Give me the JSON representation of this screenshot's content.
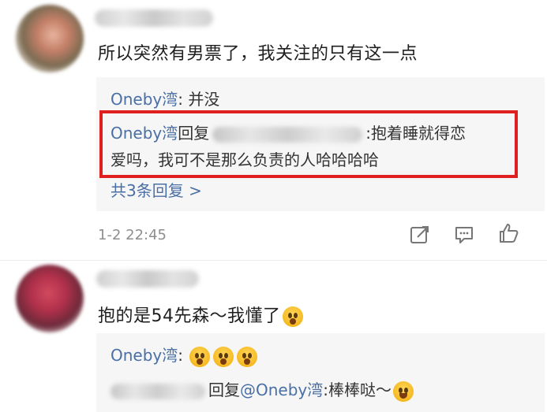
{
  "comment1": {
    "text": "所以突然有男票了，我关注的只有这一点",
    "replies": [
      {
        "author": "Oneby湾",
        "separator": ": ",
        "content": "并没"
      },
      {
        "author": "Oneby湾",
        "action": "回复",
        "content_line1": ":抱着睡就得恋",
        "content_line2": "爱吗，我可不是那么负责的人哈哈哈哈"
      }
    ],
    "more_replies": "共3条回复 >",
    "timestamp": "1-2 22:45"
  },
  "comment2": {
    "text": "抱的是54先森～我懂了",
    "replies": [
      {
        "author": "Oneby湾",
        "separator": ": "
      },
      {
        "action": "回复",
        "mention": "@Oneby湾",
        "content": ":棒棒哒～"
      }
    ]
  },
  "icons": {
    "share": "share-icon",
    "comment": "comment-icon",
    "like": "thumbs-up-icon",
    "emoji_scream": "scream-emoji-icon",
    "emoji_grin": "grin-emoji-icon"
  },
  "colors": {
    "link": "#4a6fa5",
    "highlight": "#e0201f",
    "reply_bg": "#f6f6f6",
    "meta": "#8e8e8e"
  }
}
